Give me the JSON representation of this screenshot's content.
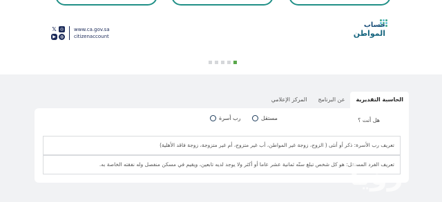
{
  "social": {
    "url": "www.ca.gov.sa",
    "handle": "citizenaccount",
    "icons": [
      "x-icon",
      "instagram-icon",
      "youtube-icon",
      "globe-icon"
    ]
  },
  "logo": {
    "line1": "حساب",
    "line2": "المواطن"
  },
  "pager": {
    "count": 5,
    "active_index": 4
  },
  "tabs": [
    {
      "label": "الحاسبة التقديرية",
      "active": true
    },
    {
      "label": "عن البرنامج",
      "active": false
    },
    {
      "label": "المركز الإعلامي",
      "active": false
    }
  ],
  "calculator": {
    "question": "هل أنت ؟",
    "options": [
      "مستقل",
      "رب أسرة"
    ]
  },
  "definitions": [
    "تعريف رب الأسرة: ذكر أو أنثى ( الزوج، زوجة غير المواطن، أب غير متزوج، أم غير متزوجة، زوجة فاقد الأهلية)",
    "تعريف الفرد المستقل: هو كل شخص تبلغ سنّه ثمانية عشر عاما أو أكثر ولا يوجد لديه تابعين، ويقيم في مسكن منفصل وله نفقته الخاصة به."
  ],
  "colors": {
    "accent": "#1f8f86",
    "pager_active": "#5aa84b",
    "navy": "#1b2a59"
  }
}
